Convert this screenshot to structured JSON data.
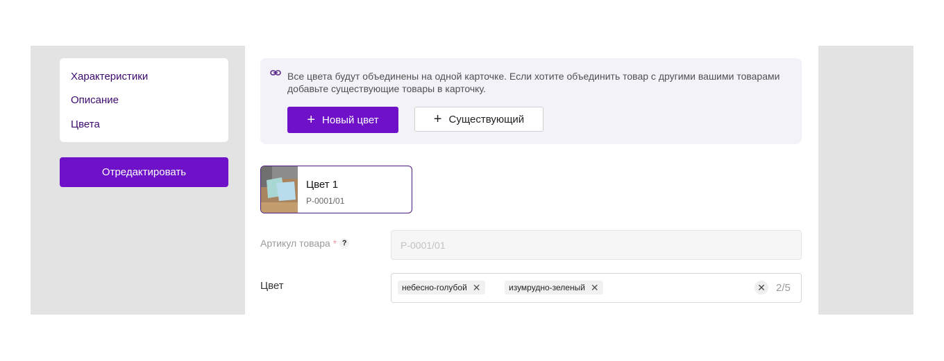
{
  "sidebar": {
    "items": [
      {
        "label": "Характеристики"
      },
      {
        "label": "Описание"
      },
      {
        "label": "Цвета"
      }
    ],
    "edit_button": "Отредактировать"
  },
  "info": {
    "text": "Все цвета будут объединены на одной карточке. Если хотите объединить товар с другими вашими товарами добавьте существующие товары в карточку.",
    "new_color_button": "Новый цвет",
    "existing_button": "Существующий",
    "icon": "link-icon"
  },
  "color_card": {
    "title": "Цвет 1",
    "sku": "P-0001/01"
  },
  "form": {
    "sku_label": "Артикул товара",
    "sku_required": "*",
    "sku_help": "?",
    "sku_placeholder": "P-0001/01",
    "color_label": "Цвет",
    "color_tags": [
      "небесно-голубой",
      "изумрудно-зеленый"
    ],
    "color_counter": "2/5"
  },
  "colors": {
    "accent": "#6e11c9",
    "nav_text": "#3a0a6e",
    "panel_bg": "#e3e3e3",
    "info_bg": "#f3f2f8"
  }
}
